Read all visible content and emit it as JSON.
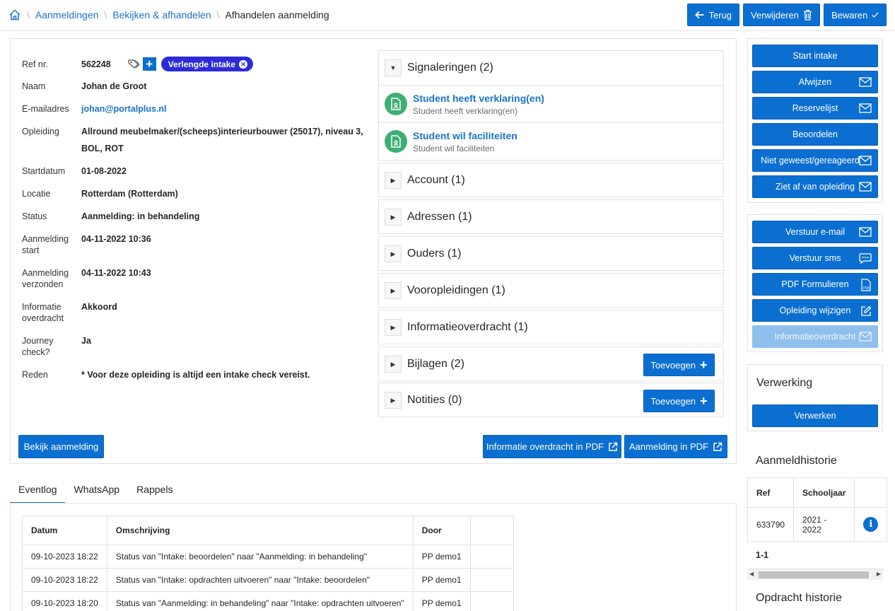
{
  "breadcrumb": {
    "items": [
      "Aanmeldingen",
      "Bekijken & afhandelen"
    ],
    "current": "Afhandelen aanmelding"
  },
  "toolbar": {
    "back_label": "Terug",
    "delete_label": "Verwijderen",
    "save_label": "Bewaren"
  },
  "registration": {
    "ref_label": "Ref nr.",
    "ref_value": "562248",
    "badge": "Verlengde intake",
    "rows": [
      {
        "label": "Naam",
        "value": "Johan de Groot"
      },
      {
        "label": "E-mailadres",
        "value": "johan@portalplus.nl"
      },
      {
        "label": "Opleiding",
        "value": "Allround meubelmaker/(scheeps)interieurbouwer (25017), niveau 3,",
        "value2": "BOL, ROT"
      },
      {
        "label": "Startdatum",
        "value": "01-08-2022"
      },
      {
        "label": "Locatie",
        "value": "Rotterdam (Rotterdam)"
      },
      {
        "label": "Status",
        "value": "Aanmelding: in behandeling"
      },
      {
        "label": "Aanmelding",
        "label2": "start",
        "value": "04-11-2022 10:36"
      },
      {
        "label": "Aanmelding",
        "label2": "verzonden",
        "value": "04-11-2022 10:43"
      },
      {
        "label": "Informatie",
        "label2": "overdracht",
        "value": "Akkoord"
      },
      {
        "label": "Journey",
        "label2": "check?",
        "value": "Ja"
      },
      {
        "label": "Reden",
        "value": "* Voor deze opleiding is altijd een intake check vereist."
      }
    ],
    "view_button": "Bekijk aanmelding",
    "info_pdf_button": "Informatie overdracht in PDF",
    "reg_pdf_button": "Aanmelding in PDF"
  },
  "accordion": {
    "signals_title": "Signaleringen (2)",
    "signals": [
      {
        "title": "Student heeft verklaring(en)",
        "subtitle": "Student heeft verklaring(en)"
      },
      {
        "title": "Student wil faciliteiten",
        "subtitle": "Student wil faciliteiten"
      }
    ],
    "sections": [
      {
        "title": "Account (1)"
      },
      {
        "title": "Adressen (1)"
      },
      {
        "title": "Ouders (1)"
      },
      {
        "title": "Vooropleidingen (1)"
      },
      {
        "title": "Informatieoverdracht (1)"
      },
      {
        "title": "Bijlagen (2)",
        "action": "Toevoegen"
      },
      {
        "title": "Notities (0)",
        "action": "Toevoegen"
      }
    ]
  },
  "actions": {
    "group1": [
      {
        "label": "Start intake",
        "icon": ""
      },
      {
        "label": "Afwijzen",
        "icon": "mail-icon"
      },
      {
        "label": "Reservelijst",
        "icon": "mail-icon"
      },
      {
        "label": "Beoordelen",
        "icon": ""
      },
      {
        "label": "Niet geweest/gereageerd",
        "icon": "mail-icon"
      },
      {
        "label": "Ziet af van opleiding",
        "icon": "mail-icon"
      }
    ],
    "group2": [
      {
        "label": "Verstuur e-mail",
        "icon": "mail-icon"
      },
      {
        "label": "Verstuur sms",
        "icon": "chat-icon"
      },
      {
        "label": "PDF Formulieren",
        "icon": "pdf-icon"
      },
      {
        "label": "Opleiding wijzigen",
        "icon": "edit-icon"
      },
      {
        "label": "Informatieoverdracht",
        "icon": "mail-icon",
        "disabled": true
      }
    ]
  },
  "processing": {
    "title": "Verwerking",
    "button": "Verwerken"
  },
  "history": {
    "title": "Aanmeldhistorie",
    "columns": [
      "Ref",
      "Schooljaar"
    ],
    "rows": [
      {
        "ref": "633790",
        "year": "2021 -",
        "year2": "2022"
      }
    ],
    "pagination": "1-1",
    "next_title": "Opdracht historie"
  },
  "tabs": [
    "Eventlog",
    "WhatsApp",
    "Rappels"
  ],
  "eventlog": {
    "columns": [
      "Datum",
      "Omschrijving",
      "Door"
    ],
    "rows": [
      {
        "date": "09-10-2023 18:22",
        "desc": "Status van \"Intake: beoordelen\" naar \"Aanmelding: in behandeling\"",
        "by": "PP demo1"
      },
      {
        "date": "09-10-2023 18:22",
        "desc": "Status van \"Intake: opdrachten uitvoeren\" naar \"Intake: beoordelen\"",
        "by": "PP demo1"
      },
      {
        "date": "09-10-2023 18:20",
        "desc": "Status van \"Aanmelding: in behandeling\" naar \"Intake: opdrachten uitvoeren\"",
        "by": "PP demo1"
      }
    ]
  },
  "colors": {
    "primary": "#0b6fd1",
    "link": "#1a73c7",
    "badge": "#2b2bd9",
    "signal": "#3fae74",
    "disabled": "#8fbfec"
  }
}
